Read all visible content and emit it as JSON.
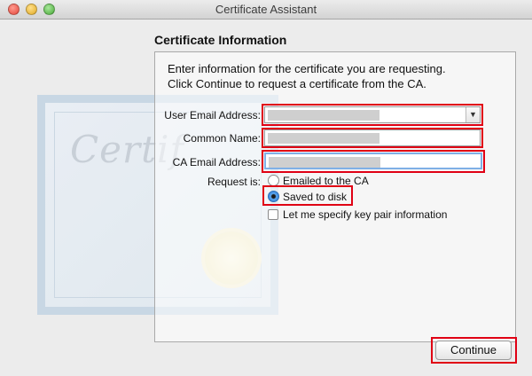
{
  "window": {
    "title": "Certificate Assistant"
  },
  "art": {
    "word": "Certif"
  },
  "section": {
    "title": "Certificate Information"
  },
  "intro": {
    "line1": "Enter information for the certificate you are requesting.",
    "line2": "Click Continue to request a certificate from the CA."
  },
  "form": {
    "user_email_label": "User Email Address:",
    "user_email_value": "",
    "common_name_label": "Common Name:",
    "common_name_value": "",
    "ca_email_label": "CA Email Address:",
    "ca_email_value": "",
    "request_label": "Request is:",
    "options": [
      {
        "label": "Emailed to the CA",
        "selected": false
      },
      {
        "label": "Saved to disk",
        "selected": true
      }
    ],
    "keypair_label": "Let me specify key pair information",
    "keypair_checked": false
  },
  "buttons": {
    "continue": "Continue"
  },
  "colors": {
    "highlight": "#e00014",
    "accent": "#2d7bd6"
  }
}
